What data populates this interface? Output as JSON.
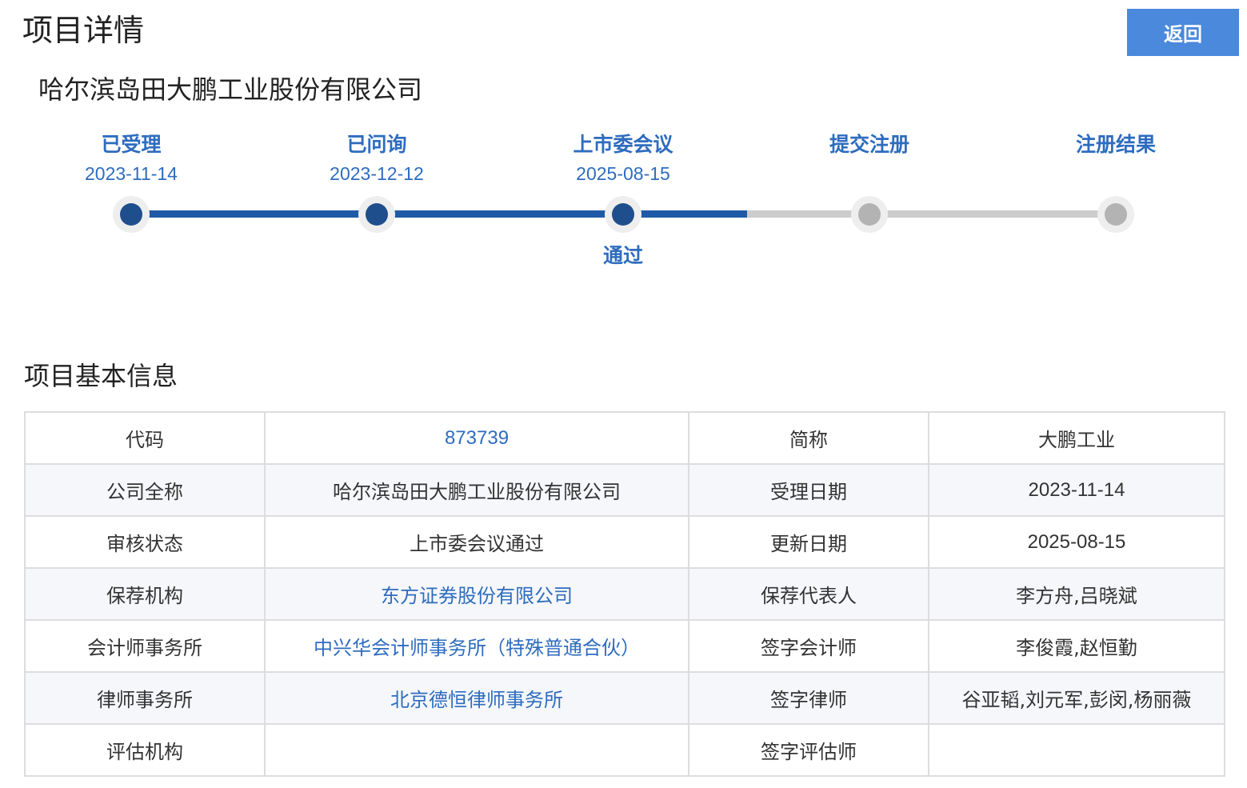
{
  "header": {
    "title": "项目详情",
    "back_label": "返回"
  },
  "company": {
    "name": "哈尔滨岛田大鹏工业股份有限公司"
  },
  "progress": {
    "steps": [
      {
        "label": "已受理",
        "date": "2023-11-14",
        "status": "done"
      },
      {
        "label": "已问询",
        "date": "2023-12-12",
        "status": "done"
      },
      {
        "label": "上市委会议",
        "date": "2025-08-15",
        "status": "done",
        "result": "通过"
      },
      {
        "label": "提交注册",
        "date": "",
        "status": "pending"
      },
      {
        "label": "注册结果",
        "date": "",
        "status": "pending"
      }
    ],
    "colors": {
      "done": "#1f4e8c",
      "pending": "#b3b3b3",
      "text": "#2e6cbf"
    }
  },
  "basic_info": {
    "title": "项目基本信息",
    "rows": [
      {
        "label1": "代码",
        "value1": "873739",
        "label2": "简称",
        "value2": "大鹏工业"
      },
      {
        "label1": "公司全称",
        "value1": "哈尔滨岛田大鹏工业股份有限公司",
        "label2": "受理日期",
        "value2": "2023-11-14"
      },
      {
        "label1": "审核状态",
        "value1": "上市委会议通过",
        "label2": "更新日期",
        "value2": "2025-08-15"
      },
      {
        "label1": "保荐机构",
        "value1": "东方证券股份有限公司",
        "label2": "保荐代表人",
        "value2": "李方舟,吕晓斌"
      },
      {
        "label1": "会计师事务所",
        "value1": "中兴华会计师事务所（特殊普通合伙）",
        "label2": "签字会计师",
        "value2": "李俊霞,赵恒勤"
      },
      {
        "label1": "律师事务所",
        "value1": "北京德恒律师事务所",
        "label2": "签字律师",
        "value2": "谷亚韬,刘元军,彭闵,杨丽薇"
      },
      {
        "label1": "评估机构",
        "value1": "",
        "label2": "签字评估师",
        "value2": ""
      }
    ]
  },
  "accent_color": "#4a89dc"
}
